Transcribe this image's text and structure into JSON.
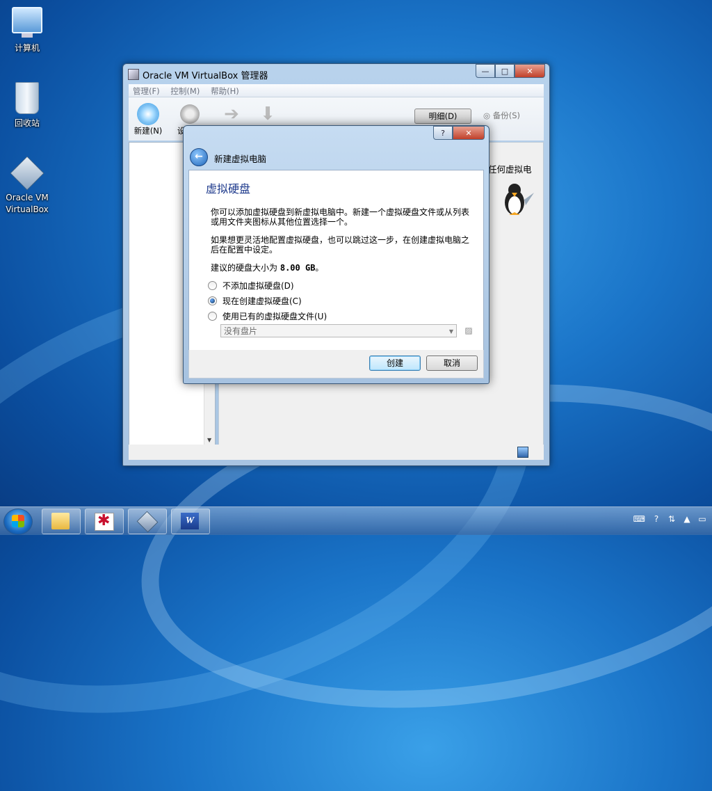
{
  "desktop": {
    "icons": [
      {
        "label": "计算机"
      },
      {
        "label": "回收站"
      },
      {
        "label": "Oracle VM VirtualBox"
      }
    ]
  },
  "main_window": {
    "title": "Oracle VM VirtualBox 管理器",
    "menu": [
      "管理(F)",
      "控制(M)",
      "帮助(H)"
    ],
    "toolbar": {
      "new": "新建(N)",
      "settings": "设",
      "detail": "明细(D)",
      "backup": "备份(S)"
    },
    "welcome_text": "任何虚拟电"
  },
  "dialog": {
    "header": "新建虚拟电脑",
    "page_title": "虚拟硬盘",
    "para1": "你可以添加虚拟硬盘到新虚拟电脑中。新建一个虚拟硬盘文件或从列表或用文件夹图标从其他位置选择一个。",
    "para2": "如果想更灵活地配置虚拟硬盘，也可以跳过这一步，在创建虚拟电脑之后在配置中设定。",
    "recommend_prefix": "建议的硬盘大小为",
    "recommend_size": "8.00 GB",
    "recommend_suffix": "。",
    "options": [
      {
        "label": "不添加虚拟硬盘(D)",
        "checked": false
      },
      {
        "label": "现在创建虚拟硬盘(C)",
        "checked": true
      },
      {
        "label": "使用已有的虚拟硬盘文件(U)",
        "checked": false
      }
    ],
    "disk_combo_value": "没有盘片",
    "create_button": "创建",
    "cancel_button": "取消",
    "help_glyph": "?",
    "close_glyph": "✕"
  },
  "taskbar": {
    "apps": [
      "folder",
      "debugger",
      "virtualbox",
      "word"
    ],
    "word_letter": "W"
  }
}
